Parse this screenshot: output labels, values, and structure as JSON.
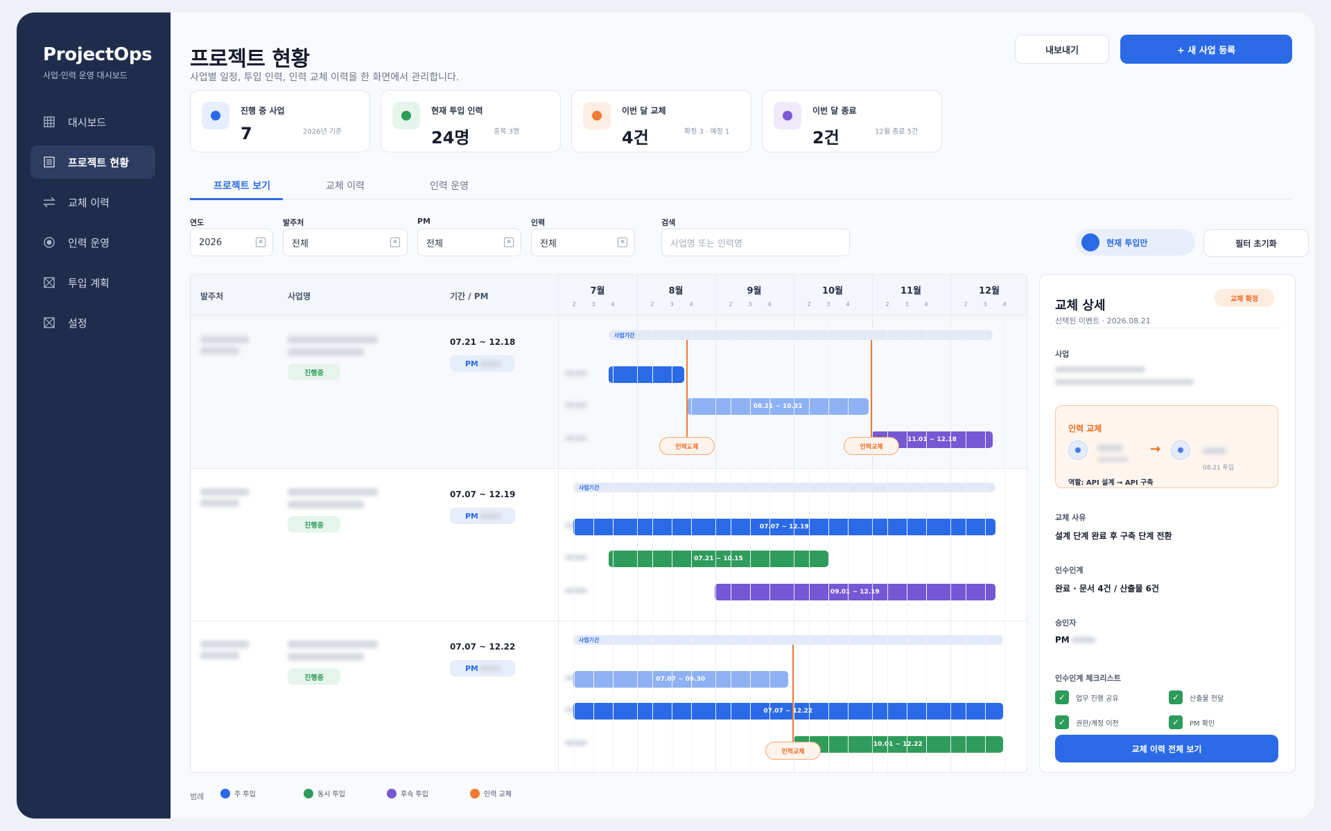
{
  "sidebar": {
    "brand": "ProjectOps",
    "brand_sub": "사업·인력 운영 대시보드",
    "items": [
      {
        "label": "대시보드",
        "icon": "grid-icon"
      },
      {
        "label": "프로젝트 현황",
        "icon": "list-icon"
      },
      {
        "label": "교체 이력",
        "icon": "swap-icon"
      },
      {
        "label": "인력 운영",
        "icon": "target-icon"
      },
      {
        "label": "투입 계획",
        "icon": "calendar-icon"
      },
      {
        "label": "설정",
        "icon": "settings-icon"
      }
    ]
  },
  "header": {
    "title": "프로젝트 현황",
    "subtitle": "사업별 일정, 투입 인력, 인력 교체 이력을 한 화면에서 관리합니다.",
    "export_label": "내보내기",
    "new_label": "+ 새 사업 등록"
  },
  "stats": [
    {
      "label": "진행 중 사업",
      "value": "7",
      "note": "2026년 기준",
      "color": "#2a6ae6",
      "bg": "#e6eefc"
    },
    {
      "label": "현재 투입 인력",
      "value": "24명",
      "note": "중복 3명",
      "color": "#2d9b5a",
      "bg": "#e6f5ec"
    },
    {
      "label": "이번 달 교체",
      "value": "4건",
      "note": "확정 3 · 예정 1",
      "color": "#f07a32",
      "bg": "#fdeee3"
    },
    {
      "label": "이번 달 종료",
      "value": "2건",
      "note": "12월 종료 5건",
      "color": "#7d5ad8",
      "bg": "#efeafb"
    }
  ],
  "tabs": [
    "프로젝트 보기",
    "교체 이력",
    "인력 운영"
  ],
  "filters": {
    "year": {
      "label": "연도",
      "value": "2026"
    },
    "client": {
      "label": "발주처",
      "value": "전체"
    },
    "pm": {
      "label": "PM",
      "value": "전체"
    },
    "staff": {
      "label": "인력",
      "value": "전체"
    },
    "search": {
      "label": "검색",
      "placeholder": "사업명 또는 인력명"
    },
    "toggle_label": "현재 투입만",
    "reset_label": "필터 초기화"
  },
  "gantt": {
    "headers": {
      "client": "발주처",
      "name": "사업명",
      "period": "기간 / PM"
    },
    "months": [
      "7월",
      "8월",
      "9월",
      "10월",
      "11월",
      "12월"
    ],
    "weeks": [
      "2",
      "3",
      "4"
    ],
    "project_bar_label": "사업기간",
    "pm_prefix": "PM",
    "replace_label": "인력교체",
    "projects": [
      {
        "period": "07.21 ~ 12.18",
        "status": "진행중",
        "span": [
          "07.21",
          "12.18"
        ],
        "bars": [
          {
            "start": "07.21",
            "end": "08.20",
            "label": "",
            "color": "#2a6ae6"
          },
          {
            "start": "08.21",
            "end": "10.31",
            "label": "08.21 ~ 10.31",
            "color": "#8eb1f4"
          },
          {
            "start": "11.01",
            "end": "12.18",
            "label": "11.01 ~ 12.18",
            "color": "#7458d4"
          }
        ],
        "replacements": [
          "08.21",
          "11.01"
        ]
      },
      {
        "period": "07.07 ~ 12.19",
        "status": "진행중",
        "span": [
          "07.07",
          "12.19"
        ],
        "bars": [
          {
            "start": "07.07",
            "end": "12.19",
            "label": "07.07 ~ 12.19",
            "color": "#2a6ae6"
          },
          {
            "start": "07.21",
            "end": "10.15",
            "label": "07.21 ~ 10.15",
            "color": "#2f9c5c"
          },
          {
            "start": "09.01",
            "end": "12.19",
            "label": "09.01 ~ 12.19",
            "color": "#7458d4"
          }
        ],
        "replacements": []
      },
      {
        "period": "07.07 ~ 12.22",
        "status": "진행중",
        "span": [
          "07.07",
          "12.22"
        ],
        "bars": [
          {
            "start": "07.07",
            "end": "09.30",
            "label": "07.07 ~ 09.30",
            "color": "#8eb1f4"
          },
          {
            "start": "07.07",
            "end": "12.22",
            "label": "07.07 ~ 12.22",
            "color": "#2a6ae6"
          },
          {
            "start": "10.01",
            "end": "12.22",
            "label": "10.01 ~ 12.22",
            "color": "#2f9c5c"
          }
        ],
        "replacements": [
          "10.01"
        ]
      }
    ]
  },
  "legend": {
    "title": "범례",
    "items": [
      {
        "label": "주 투입",
        "color": "#2a6ae6"
      },
      {
        "label": "동시 투입",
        "color": "#2f9c5c"
      },
      {
        "label": "후속 투입",
        "color": "#7458d4"
      },
      {
        "label": "인력 교체",
        "color": "#f07a32"
      }
    ]
  },
  "detail": {
    "title": "교체 상세",
    "subtitle": "선택된 이벤트 · 2026.08.21",
    "status": "교체 확정",
    "project_label": "사업",
    "replace_title": "인력 교체",
    "replace_date": "08.21 투입",
    "role": "역할: API 설계 → API 구축",
    "reason_label": "교체 사유",
    "reason": "설계 단계 완료 후 구축 단계 전환",
    "handover_label": "인수인계",
    "handover": "완료 · 문서 4건 / 산출물 6건",
    "approver_label": "승인자",
    "approver": "PM",
    "checklist_label": "인수인계 체크리스트",
    "checklist": [
      "업무 진행 공유",
      "산출물 전달",
      "권한/계정 이전",
      "PM 확인"
    ],
    "history_button": "교체 이력 전체 보기"
  }
}
